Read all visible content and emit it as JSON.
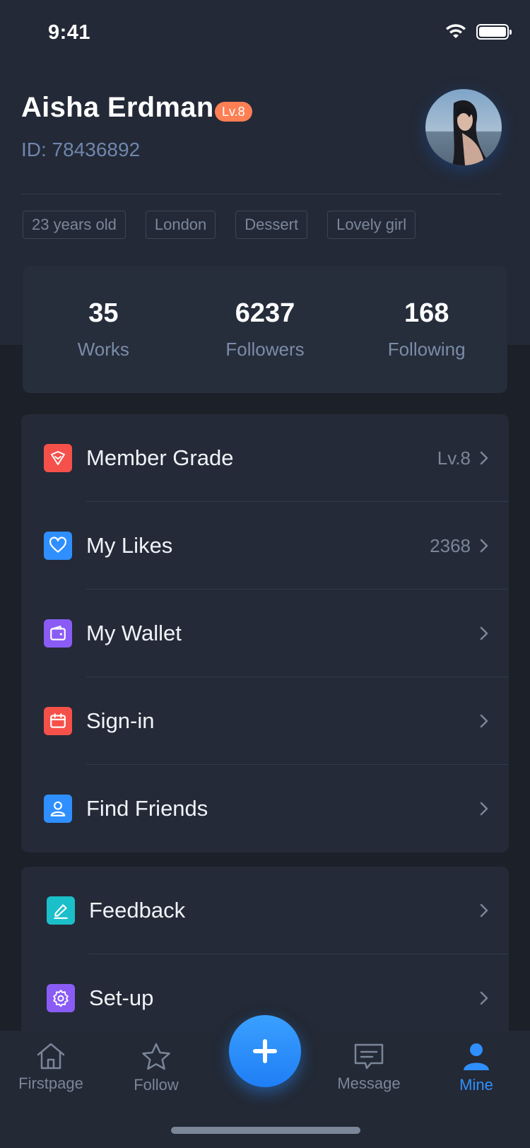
{
  "status_bar": {
    "time": "9:41"
  },
  "profile": {
    "name": "Aisha Erdman",
    "level": "Lv.8",
    "id": "ID: 78436892",
    "tags": [
      "23 years old",
      "London",
      "Dessert",
      "Lovely girl"
    ]
  },
  "stats": [
    {
      "value": "35",
      "label": "Works"
    },
    {
      "value": "6237",
      "label": "Followers"
    },
    {
      "value": "168",
      "label": "Following"
    }
  ],
  "menu_primary": [
    {
      "label": "Member Grade",
      "value": "Lv.8",
      "icon": "member-grade-icon",
      "color": "#f5514a"
    },
    {
      "label": "My Likes",
      "value": "2368",
      "icon": "heart-icon",
      "color": "#2f8ffe"
    },
    {
      "label": "My Wallet",
      "value": "",
      "icon": "wallet-icon",
      "color": "#8a5cf5"
    },
    {
      "label": "Sign-in",
      "value": "",
      "icon": "calendar-icon",
      "color": "#f5514a"
    },
    {
      "label": "Find Friends",
      "value": "",
      "icon": "user-icon",
      "color": "#2f8ffe"
    }
  ],
  "menu_secondary": [
    {
      "label": "Feedback",
      "icon": "edit-icon",
      "color": "#1bbfc9"
    },
    {
      "label": "Set-up",
      "icon": "gear-icon",
      "color": "#8a5cf5"
    }
  ],
  "tabbar": {
    "firstpage": "Firstpage",
    "follow": "Follow",
    "message": "Message",
    "mine": "Mine"
  },
  "colors": {
    "accent": "#2f8ffe",
    "level_badge": "#ff7f55",
    "background": "#1b2029",
    "card": "#242a37"
  }
}
